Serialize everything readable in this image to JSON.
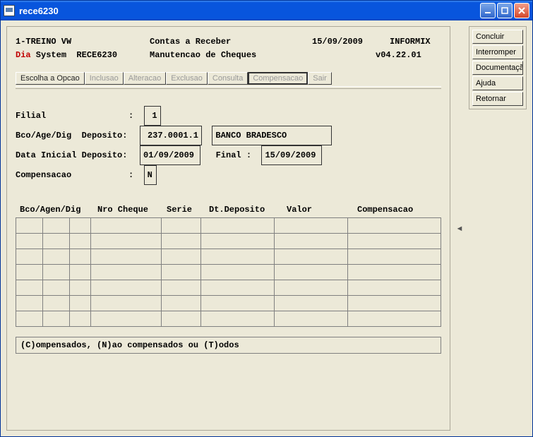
{
  "window": {
    "title": "rece6230"
  },
  "right_buttons": [
    "Concluir",
    "Interromper",
    "Documentação",
    "Ajuda",
    "Retornar"
  ],
  "header": {
    "org": "1-TREINO VW",
    "module": "Contas a Receber",
    "date": "15/09/2009",
    "db": "INFORMIX",
    "sys_prefix": "Dia",
    "sys": " System  RECE6230",
    "screen": "Manutencao de Cheques",
    "version": "v04.22.01"
  },
  "tabs": {
    "escolha": "Escolha a Opcao",
    "inclusao": "Inclusao",
    "alteracao": "Alteracao",
    "exclusao": "Exclusao",
    "consulta": "Consulta",
    "compensacao": "Compensacao",
    "sair": "Sair"
  },
  "form": {
    "filial_label": "Filial",
    "filial_value": "1",
    "bco_label": "Bco/Age/Dig  Deposito:",
    "bco_value": "237.0001.1",
    "bco_name": "BANCO BRADESCO",
    "data_ini_label": "Data Inicial Deposito:",
    "data_ini_value": "01/09/2009",
    "final_label": "Final :",
    "final_value": "15/09/2009",
    "comp_label": "Compensacao",
    "comp_value": "N"
  },
  "columns": {
    "c1": "Bco/Agen/Dig",
    "c2": "Nro Cheque",
    "c3": "Serie",
    "c4": "Dt.Deposito",
    "c5": "Valor",
    "c6": "Compensacao"
  },
  "status": "(C)ompensados, (N)ao compensados ou (T)odos",
  "side_arrow": "◄"
}
